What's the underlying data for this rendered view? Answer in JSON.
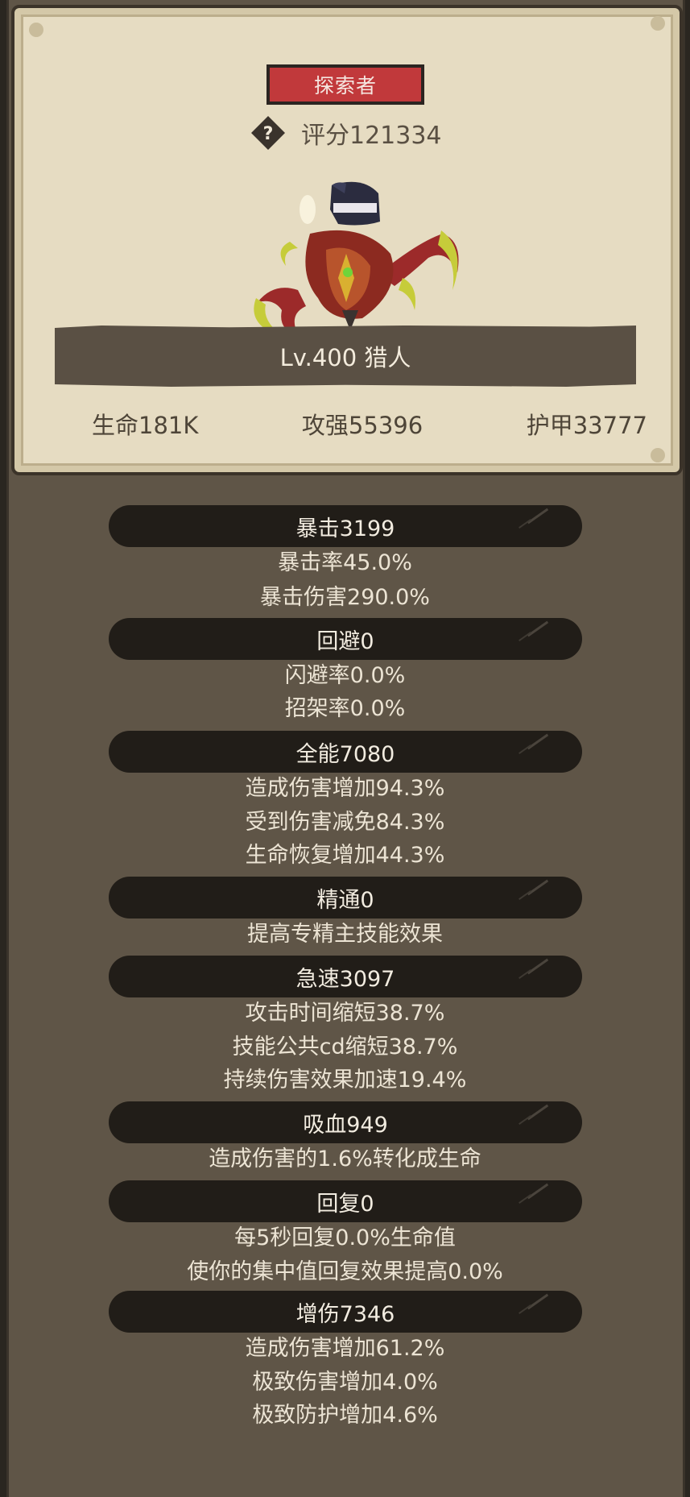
{
  "profile": {
    "class_badge": "探索者",
    "score": "评分121334",
    "name_level": "Lv.400 猎人",
    "stats": {
      "hp": "生命181K",
      "attack": "攻强55396",
      "armor": "护甲33777"
    }
  },
  "sections": [
    {
      "header": "暴击3199",
      "lines": [
        "暴击率45.0%",
        "暴击伤害290.0%"
      ]
    },
    {
      "header": "回避0",
      "lines": [
        "闪避率0.0%",
        "招架率0.0%"
      ]
    },
    {
      "header": "全能7080",
      "lines": [
        "造成伤害增加94.3%",
        "受到伤害减免84.3%",
        "生命恢复增加44.3%"
      ]
    },
    {
      "header": "精通0",
      "lines": [
        "提高专精主技能效果"
      ]
    },
    {
      "header": "急速3097",
      "lines": [
        "攻击时间缩短38.7%",
        "技能公共cd缩短38.7%",
        "持续伤害效果加速19.4%"
      ]
    },
    {
      "header": "吸血949",
      "lines": [
        "造成伤害的1.6%转化成生命"
      ]
    },
    {
      "header": "回复0",
      "lines": [
        "每5秒回复0.0%生命值",
        "使你的集中值回复效果提高0.0%"
      ]
    },
    {
      "header": "增伤7346",
      "lines": [
        "造成伤害增加61.2%",
        "极致伤害增加4.0%",
        "极致防护增加4.6%"
      ]
    }
  ],
  "colors": {
    "panel": "#5f5547",
    "card": "#e6dcc2",
    "badge": "#c1393b",
    "pill": "#211d18",
    "text_light": "#ece4d4"
  }
}
